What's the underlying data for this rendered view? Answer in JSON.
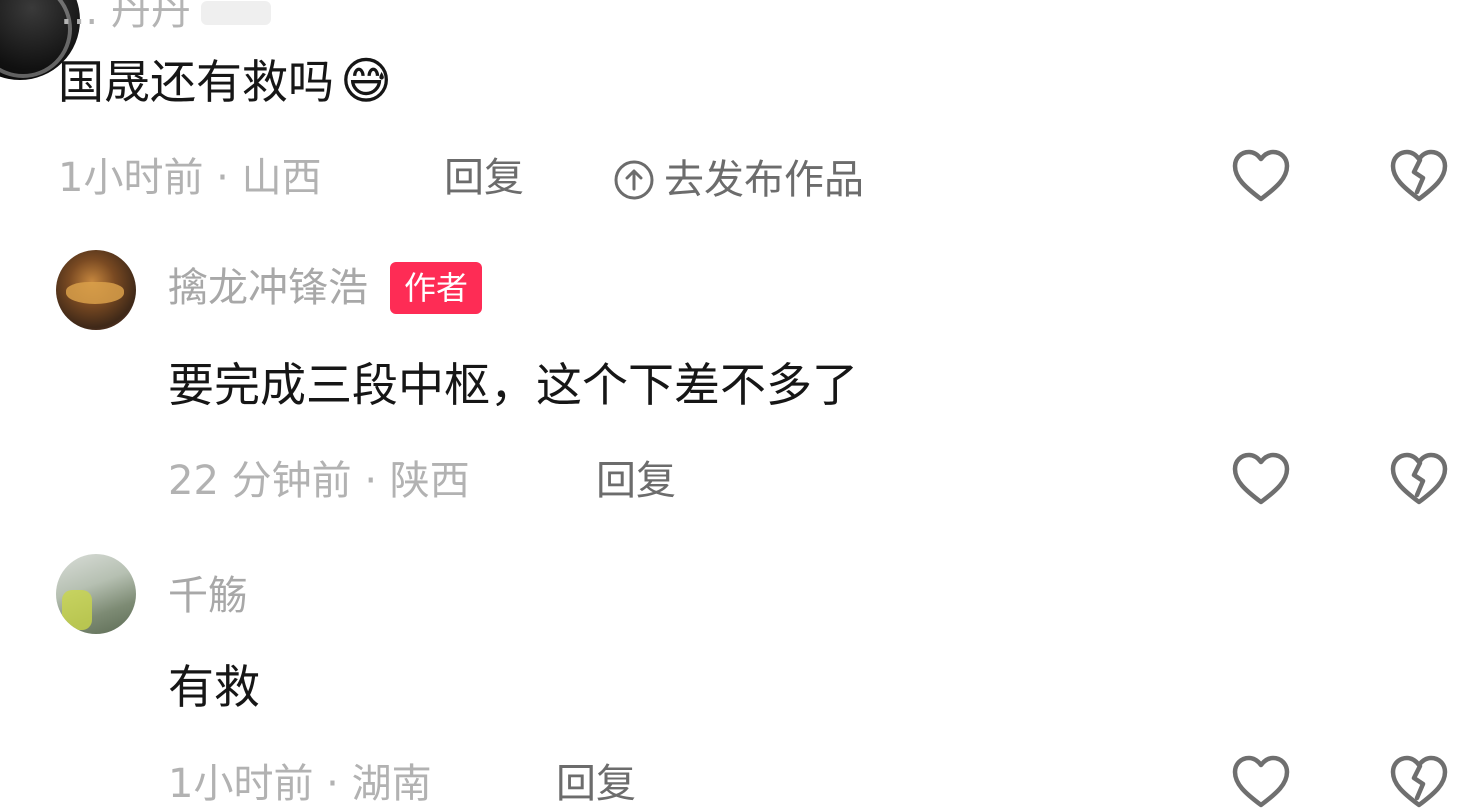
{
  "top_partial": {
    "username_cut": "...  丹丹"
  },
  "comments": [
    {
      "text": "国晟还有救吗",
      "emoji": "😅",
      "time_location": "1小时前 · 山西",
      "reply_label": "回复",
      "publish_label": "去发布作品"
    },
    {
      "username": "擒龙冲锋浩",
      "badge": "作者",
      "text": "要完成三段中枢，这个下差不多了",
      "time_location": "22 分钟前 · 陕西",
      "reply_label": "回复"
    },
    {
      "username": "千觞",
      "text": "有救",
      "time_location": "1小时前 · 湖南",
      "reply_label": "回复"
    }
  ],
  "icons": {
    "like": "heart-outline-icon",
    "dislike": "broken-heart-icon",
    "publish": "arrow-up-circle-icon"
  },
  "colors": {
    "badge": "#fe2c55",
    "text": "#161616",
    "meta": "#b2b2b2",
    "reply": "#6c6c6c"
  }
}
